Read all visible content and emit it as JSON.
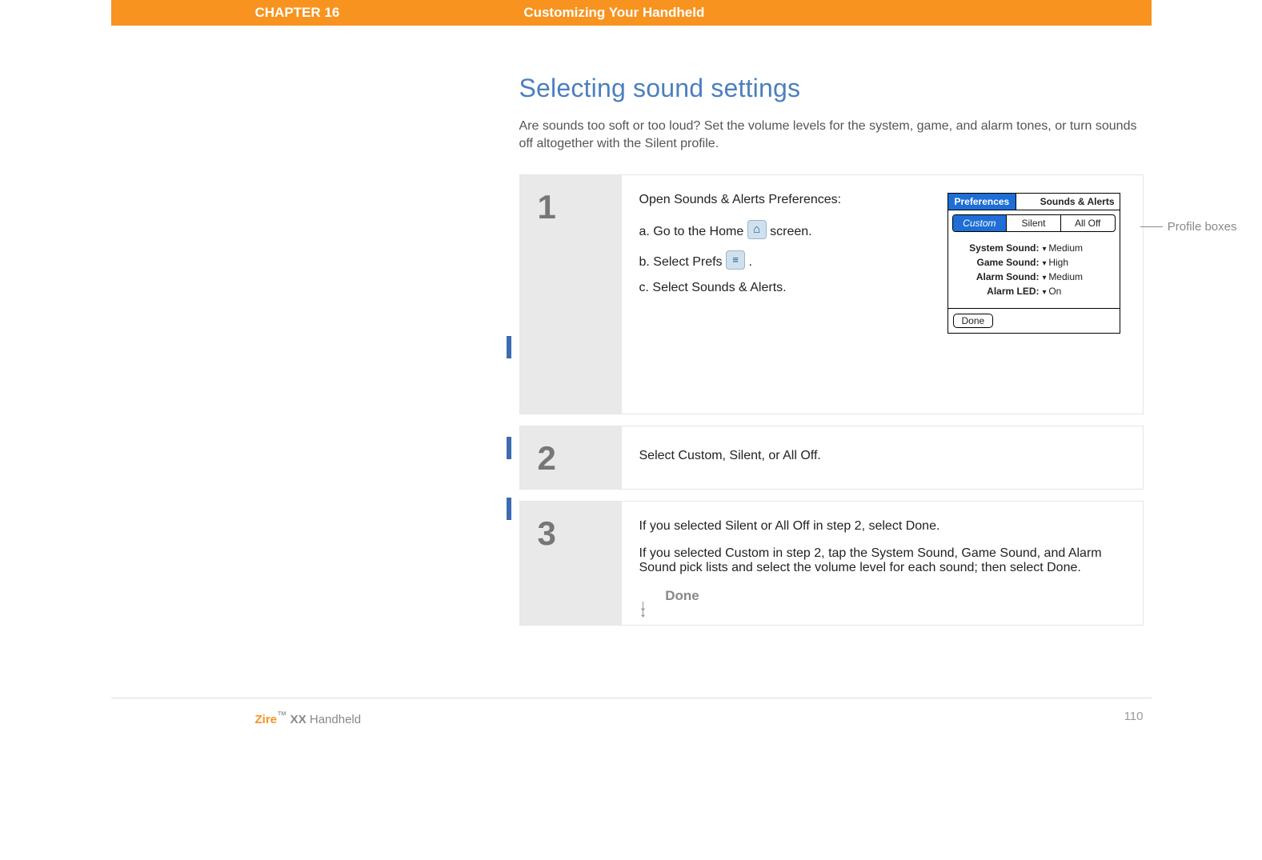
{
  "header": {
    "chapter": "CHAPTER 16",
    "title": "Customizing Your Handheld"
  },
  "section": {
    "heading": "Selecting sound settings",
    "intro": "Are sounds too soft or too loud? Set the volume levels for the system, game, and alarm tones, or turn sounds off altogether with the Silent profile."
  },
  "steps": {
    "s1": {
      "num": "1",
      "lead": "Open Sounds & Alerts Preferences:",
      "a_pre": "a.  Go to the Home ",
      "a_post": " screen.",
      "b_pre": "b.  Select Prefs ",
      "b_post": ".",
      "c": "c.  Select Sounds & Alerts.",
      "annot": "Profile boxes"
    },
    "s2": {
      "num": "2",
      "text": "Select Custom, Silent, or All Off."
    },
    "s3": {
      "num": "3",
      "p1": "If you selected Silent or All Off in step 2, select Done.",
      "p2": "If you selected Custom in step 2, tap the System Sound, Game Sound, and Alarm Sound pick lists and select the volume level for each sound; then select Done.",
      "done": "Done"
    }
  },
  "pref_screen": {
    "title_left": "Preferences",
    "title_right": "Sounds & Alerts",
    "tabs": {
      "custom": "Custom",
      "silent": "Silent",
      "alloff": "All Off"
    },
    "rows": {
      "system": {
        "label": "System Sound:",
        "value": "Medium"
      },
      "game": {
        "label": "Game Sound:",
        "value": "High"
      },
      "alarm": {
        "label": "Alarm Sound:",
        "value": "Medium"
      },
      "led": {
        "label": "Alarm LED:",
        "value": "On"
      }
    },
    "done": "Done"
  },
  "footer": {
    "brand_strong": "Zire",
    "brand_tm": "™",
    "brand_model": " XX",
    "brand_rest": " Handheld",
    "page": "110"
  }
}
